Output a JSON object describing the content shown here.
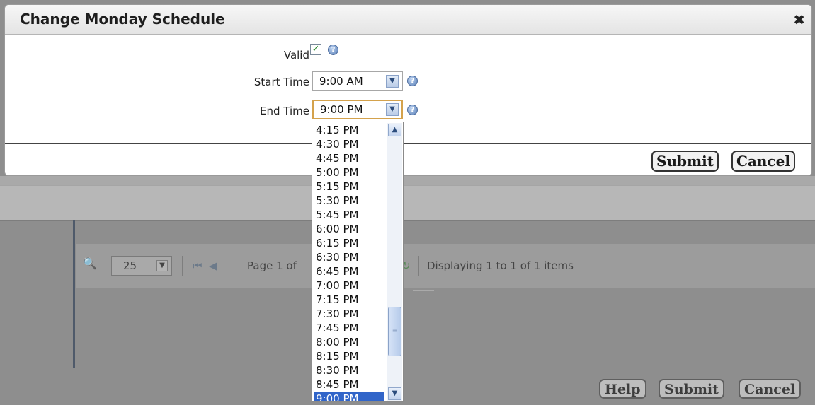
{
  "dialog": {
    "title": "Change Monday Schedule",
    "close_glyph": "✖",
    "valid_label": "Valid",
    "valid_checked": true,
    "start_label": "Start Time",
    "start_value": "9:00 AM",
    "end_label": "End Time",
    "end_value": "9:00 PM",
    "submit_label": "Submit",
    "cancel_label": "Cancel"
  },
  "dropdown": {
    "options": [
      "4:15 PM",
      "4:30 PM",
      "4:45 PM",
      "5:00 PM",
      "5:15 PM",
      "5:30 PM",
      "5:45 PM",
      "6:00 PM",
      "6:15 PM",
      "6:30 PM",
      "6:45 PM",
      "7:00 PM",
      "7:15 PM",
      "7:30 PM",
      "7:45 PM",
      "8:00 PM",
      "8:15 PM",
      "8:30 PM",
      "8:45 PM",
      "9:00 PM"
    ],
    "selected": "9:00 PM"
  },
  "background": {
    "help_label": "Help",
    "submit_label": "Submit",
    "cancel_label": "Cancel",
    "page_size": "25",
    "page_text": "Page 1 of",
    "display_text": "Displaying 1 to 1 of 1 items"
  },
  "colors": {
    "selection": "#3165c9",
    "focus_border": "#d4a24c",
    "overlay": "#8e8e8e"
  }
}
